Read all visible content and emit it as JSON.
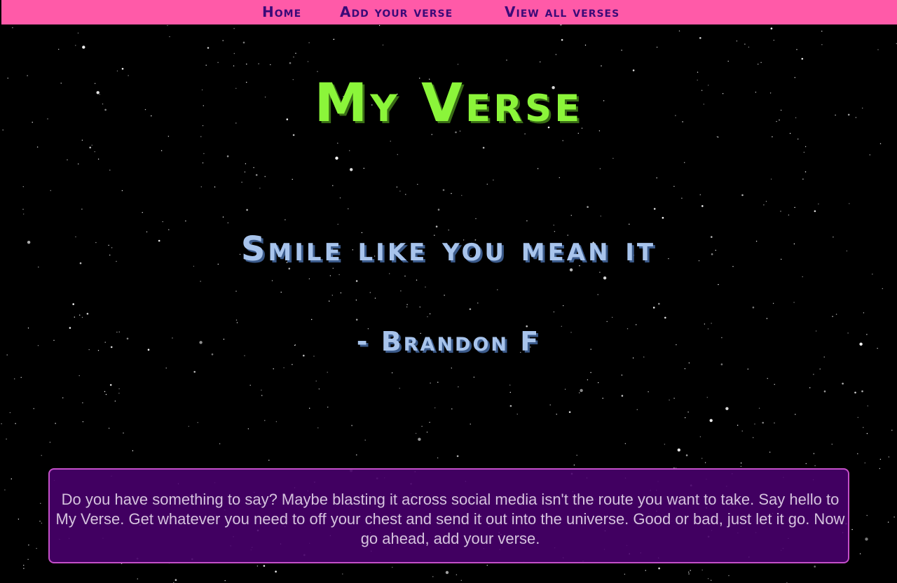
{
  "nav": {
    "items": [
      {
        "label": "Home"
      },
      {
        "label": "Add your verse"
      },
      {
        "label": "View all verses"
      }
    ]
  },
  "header": {
    "title": "My Verse"
  },
  "verse": {
    "text": "Smile like you mean it",
    "author": "- Brandon F"
  },
  "intro": {
    "text": "Do you have something to say? Maybe blasting it across social media isn't the route you want to take. Say hello to My Verse. Get whatever you need to off your chest and send it out into the universe. Good or bad, just let it go. Now go ahead, add your verse."
  },
  "colors": {
    "nav_background": "#ff5aa8",
    "nav_text": "#3b0a78",
    "title": "#8bf53a",
    "verse": "#a8c4ec",
    "intro_background": "#4a006e",
    "intro_border": "#c44fc9",
    "intro_text": "#d6c3de",
    "page_background": "#000000"
  }
}
